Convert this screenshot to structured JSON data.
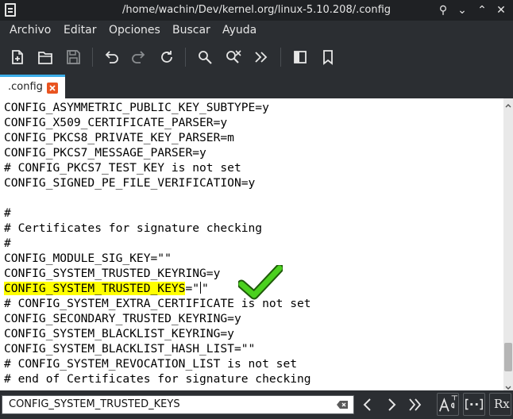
{
  "window": {
    "title": "/home/wachin/Dev/kernel.org/linux-5.10.208/.config",
    "pin_glyph": "⚲",
    "minimize_glyph": "⌄",
    "maximize_glyph": "⌃",
    "close_glyph": "✕"
  },
  "menu": {
    "items": [
      "Archivo",
      "Editar",
      "Opciones",
      "Buscar",
      "Ayuda"
    ]
  },
  "toolbar": {
    "icons": [
      "new-file-icon",
      "open-folder-icon",
      "save-icon",
      "undo-icon",
      "redo-icon",
      "reload-icon",
      "find-icon",
      "find-replace-icon",
      "jump-icon",
      "side-pane-icon",
      "bookmark-icon"
    ]
  },
  "tabs": [
    {
      "label": ".config",
      "active": true
    }
  ],
  "editor": {
    "lines": [
      "CONFIG_ASYMMETRIC_PUBLIC_KEY_SUBTYPE=y",
      "CONFIG_X509_CERTIFICATE_PARSER=y",
      "CONFIG_PKCS8_PRIVATE_KEY_PARSER=m",
      "CONFIG_PKCS7_MESSAGE_PARSER=y",
      "# CONFIG_PKCS7_TEST_KEY is not set",
      "CONFIG_SIGNED_PE_FILE_VERIFICATION=y",
      "",
      "#",
      "# Certificates for signature checking",
      "#",
      "CONFIG_MODULE_SIG_KEY=\"\"",
      "CONFIG_SYSTEM_TRUSTED_KEYRING=y",
      "",
      "# CONFIG_SYSTEM_EXTRA_CERTIFICATE is not set",
      "CONFIG_SECONDARY_TRUSTED_KEYRING=y",
      "CONFIG_SYSTEM_BLACKLIST_KEYRING=y",
      "CONFIG_SYSTEM_BLACKLIST_HASH_LIST=\"\"",
      "# CONFIG_SYSTEM_REVOCATION_LIST is not set",
      "# end of Certificates for signature checking"
    ],
    "highlighted_line": {
      "highlight": "CONFIG_SYSTEM_TRUSTED_KEYS",
      "before_caret": "=\"",
      "after_caret": "\""
    },
    "highlight_color": "#ffff00",
    "checkmark_color": "#4bd11e",
    "scroll_position": 0.93
  },
  "search": {
    "value": "CONFIG_SYSTEM_TRUSTED_KEYS",
    "regex_button_label": "Rx"
  },
  "colors": {
    "accent": "#3daee9",
    "tab_close": "#e95420",
    "chrome_bg": "#2b2e32"
  }
}
